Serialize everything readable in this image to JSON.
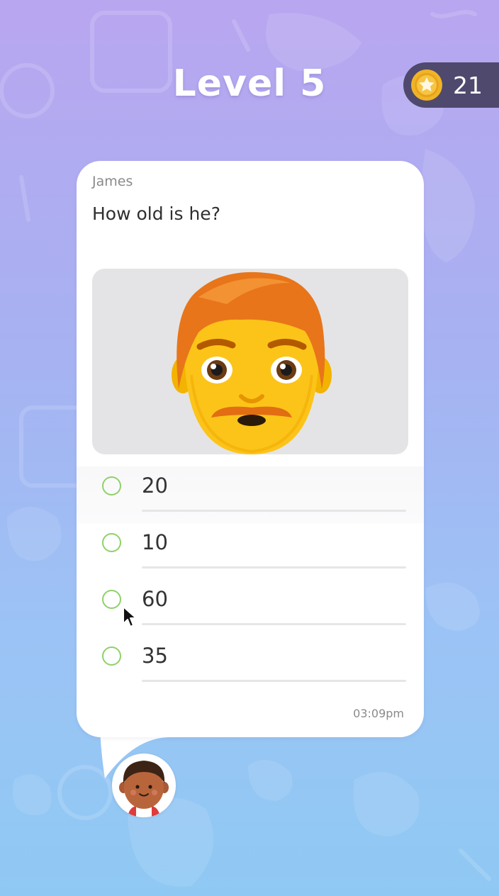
{
  "header": {
    "level_title": "Level 5",
    "coins": "21"
  },
  "message": {
    "sender": "James",
    "question": "How old is he?",
    "image_icon": "man-red-hair-mustache-emoji",
    "options": [
      {
        "label": "20"
      },
      {
        "label": "10"
      },
      {
        "label": "60"
      },
      {
        "label": "35"
      }
    ],
    "timestamp": "03:09pm"
  },
  "colors": {
    "background_top": "#b9a6f0",
    "background_bottom": "#8fc9f3",
    "radio_accent": "#8fd16a",
    "coin_pill": "#3c3856"
  },
  "icons": {
    "coin": "star-coin-icon",
    "avatar": "boy-avatar-icon",
    "cursor": "mouse-pointer-icon"
  }
}
